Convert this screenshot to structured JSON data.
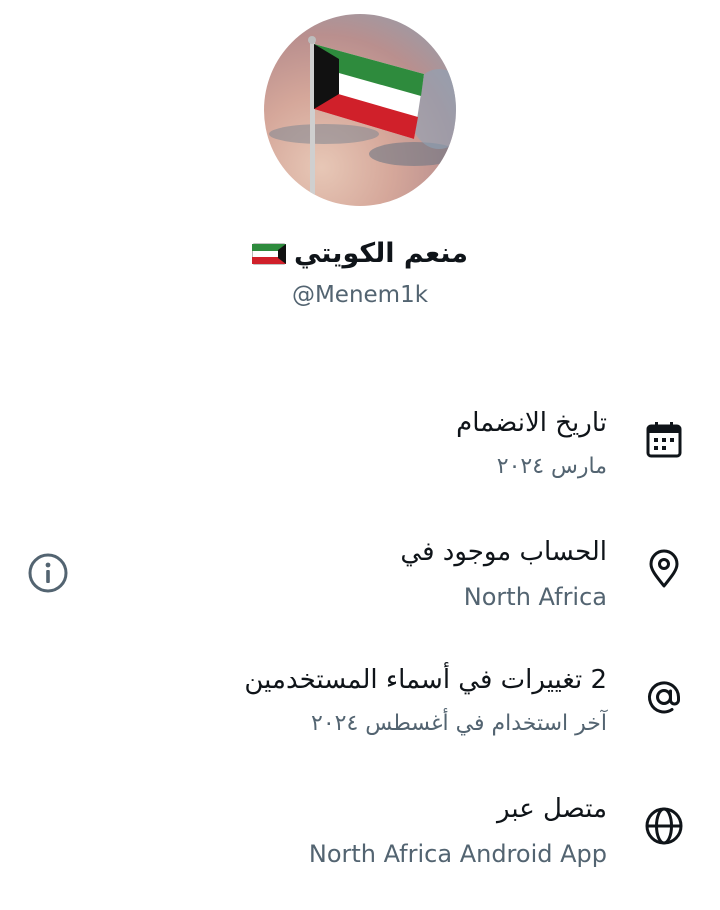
{
  "profile": {
    "display_name": "منعم الكويتي",
    "handle": "@Menem1k",
    "avatar_icon": "kuwait-flag",
    "name_badge_icon": "kuwait-flag-emoji"
  },
  "about": {
    "items": [
      {
        "icon": "calendar-icon",
        "title": "تاريخ الانضمام",
        "subtitle": "مارس ٢٠٢٤"
      },
      {
        "icon": "location-pin-icon",
        "title": "الحساب موجود في",
        "subtitle": "North Africa"
      },
      {
        "icon": "at-sign-icon",
        "title": "2 تغييرات في أسماء المستخدمين",
        "subtitle": "آخر استخدام في أغسطس ٢٠٢٤"
      },
      {
        "icon": "globe-icon",
        "title": "متصل عبر",
        "subtitle": "North Africa Android App"
      }
    ],
    "info_icon": "info-icon"
  },
  "colors": {
    "text_primary": "#0f1419",
    "text_secondary": "#536471",
    "icon": "#0f1419",
    "info_icon": "#536471",
    "flag_green": "#2e8b3d",
    "flag_white": "#ffffff",
    "flag_red": "#d0202a",
    "flag_black": "#111111"
  }
}
